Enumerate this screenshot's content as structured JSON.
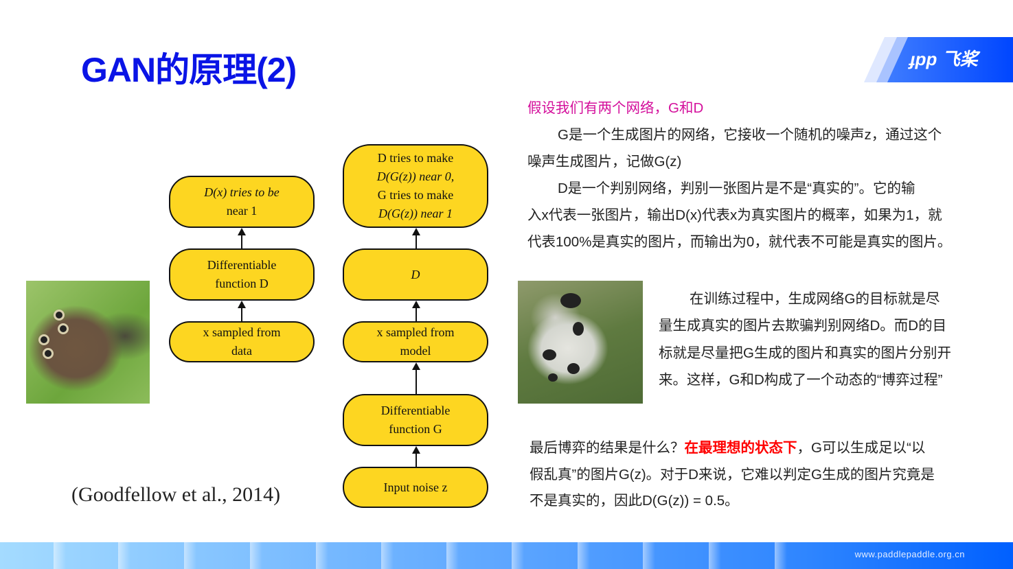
{
  "title": "GAN的原理(2)",
  "logo": {
    "text": "飞桨"
  },
  "diagram": {
    "left": [
      {
        "lines": [
          "D(x) tries to be",
          "near 1"
        ]
      },
      {
        "lines": [
          "Differentiable",
          "function D"
        ]
      },
      {
        "lines": [
          "x sampled from",
          "data"
        ]
      }
    ],
    "right": [
      {
        "lines": [
          "D tries to make",
          "D(G(z)) near 0,",
          "G tries to make",
          "D(G(z)) near 1"
        ]
      },
      {
        "lines": [
          "D"
        ]
      },
      {
        "lines": [
          "x sampled from",
          "model"
        ]
      },
      {
        "lines": [
          "Differentiable",
          "function G"
        ]
      },
      {
        "lines": [
          "Input noise z"
        ]
      }
    ],
    "citation": "(Goodfellow et al., 2014)"
  },
  "text": {
    "heading": "假设我们有两个网络，G和D",
    "para1": [
      "G是一个生成图片的网络，它接收一个随机的噪声z，通过这个",
      "噪声生成图片，记做G(z)"
    ],
    "para2": [
      "D是一个判别网络，判别一张图片是不是“真实的”。它的输",
      "入x代表一张图片，输出D(x)代表x为真实图片的概率，如果为1，就",
      "代表100%是真实的图片，而输出为0，就代表不可能是真实的图片。"
    ],
    "para3": [
      "在训练过程中，生成网络G的目标就是尽",
      "量生成真实的图片去欺骗判别网络D。而D的目",
      "标就是尽量把G生成的图片和真实的图片分别开",
      "来。这样，G和D构成了一个动态的“博弈过程”"
    ],
    "para4_a": "最后博弈的结果是什么？",
    "para4_red": "在最理想的状态下",
    "para4_b": "，G可以生成足以“以",
    "para4_lines": [
      "假乱真”的图片G(z)。对于D来说，它难以判定G生成的图片究竟是",
      "不是真实的，因此D(G(z)) = 0.5。"
    ]
  },
  "footer": {
    "url": "www.paddlepaddle.org.cn"
  },
  "colors": {
    "title": "#0a14e6",
    "heading": "#d4109c",
    "highlight": "#ff0000",
    "box": "#fdd621"
  }
}
